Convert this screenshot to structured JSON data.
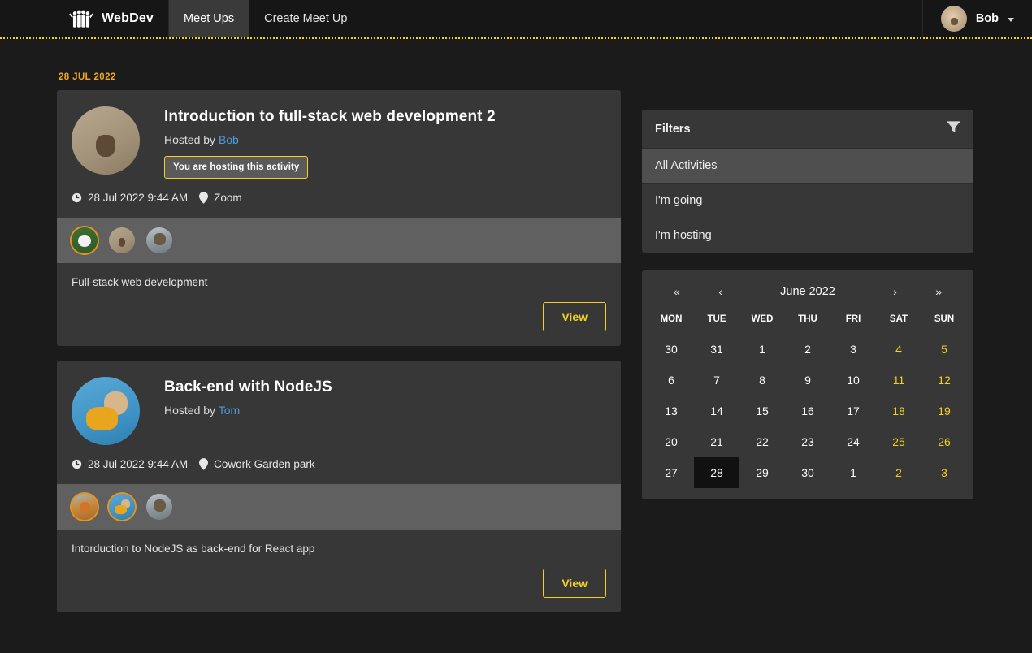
{
  "navbar": {
    "logo_icon": "group-people-icon",
    "brand": "WebDev",
    "tabs": [
      {
        "label": "Meet Ups",
        "active": true
      },
      {
        "label": "Create Meet Up",
        "active": false
      }
    ],
    "user": {
      "name": "Bob",
      "avatar": "dog-portrait-avatar",
      "caret_icon": "caret-down-icon"
    }
  },
  "page": {
    "date_header": "28 JUL 2022"
  },
  "activities": [
    {
      "title": "Introduction to full-stack web development 2",
      "hosted_by_label": "Hosted by",
      "host": "Bob",
      "hosting_badge": "You are hosting this activity",
      "show_badge": true,
      "clock_icon": "clock-icon",
      "datetime": "28 Jul 2022 9:44 AM",
      "marker_icon": "map-marker-icon",
      "venue": "Zoom",
      "description": "Full-stack web development",
      "view_label": "View",
      "avatar": "dog-on-couch-avatar",
      "attendees": [
        {
          "name": "panda-avatar",
          "host": true
        },
        {
          "name": "dog-on-couch-avatar",
          "host": false
        },
        {
          "name": "cat-avatar",
          "host": false
        }
      ]
    },
    {
      "title": "Back-end with NodeJS",
      "hosted_by_label": "Hosted by",
      "host": "Tom",
      "hosting_badge": "",
      "show_badge": false,
      "clock_icon": "clock-icon",
      "datetime": "28 Jul 2022 9:44 AM",
      "marker_icon": "map-marker-icon",
      "venue": "Cowork Garden park",
      "description": "Intorduction to NodeJS as back-end for React app",
      "view_label": "View",
      "avatar": "dog-in-yellow-hoodie-avatar",
      "attendees": [
        {
          "name": "fox-avatar",
          "host": true
        },
        {
          "name": "dog-in-yellow-hoodie-avatar",
          "host": true
        },
        {
          "name": "cat-avatar",
          "host": false
        }
      ]
    }
  ],
  "filters": {
    "title": "Filters",
    "icon": "funnel-icon",
    "items": [
      {
        "label": "All Activities",
        "active": true
      },
      {
        "label": "I'm going",
        "active": false
      },
      {
        "label": "I'm hosting",
        "active": false
      }
    ]
  },
  "calendar": {
    "month_label": "June 2022",
    "nav": {
      "prev_year": "«",
      "prev_month": "‹",
      "next_month": "›",
      "next_year": "»"
    },
    "day_names": [
      "MON",
      "TUE",
      "WED",
      "THU",
      "FRI",
      "SAT",
      "SUN"
    ],
    "weeks": [
      [
        {
          "d": "30",
          "weekend": false,
          "selected": false
        },
        {
          "d": "31",
          "weekend": false,
          "selected": false
        },
        {
          "d": "1",
          "weekend": false,
          "selected": false
        },
        {
          "d": "2",
          "weekend": false,
          "selected": false
        },
        {
          "d": "3",
          "weekend": false,
          "selected": false
        },
        {
          "d": "4",
          "weekend": true,
          "selected": false
        },
        {
          "d": "5",
          "weekend": true,
          "selected": false
        }
      ],
      [
        {
          "d": "6",
          "weekend": false,
          "selected": false
        },
        {
          "d": "7",
          "weekend": false,
          "selected": false
        },
        {
          "d": "8",
          "weekend": false,
          "selected": false
        },
        {
          "d": "9",
          "weekend": false,
          "selected": false
        },
        {
          "d": "10",
          "weekend": false,
          "selected": false
        },
        {
          "d": "11",
          "weekend": true,
          "selected": false
        },
        {
          "d": "12",
          "weekend": true,
          "selected": false
        }
      ],
      [
        {
          "d": "13",
          "weekend": false,
          "selected": false
        },
        {
          "d": "14",
          "weekend": false,
          "selected": false
        },
        {
          "d": "15",
          "weekend": false,
          "selected": false
        },
        {
          "d": "16",
          "weekend": false,
          "selected": false
        },
        {
          "d": "17",
          "weekend": false,
          "selected": false
        },
        {
          "d": "18",
          "weekend": true,
          "selected": false
        },
        {
          "d": "19",
          "weekend": true,
          "selected": false
        }
      ],
      [
        {
          "d": "20",
          "weekend": false,
          "selected": false
        },
        {
          "d": "21",
          "weekend": false,
          "selected": false
        },
        {
          "d": "22",
          "weekend": false,
          "selected": false
        },
        {
          "d": "23",
          "weekend": false,
          "selected": false
        },
        {
          "d": "24",
          "weekend": false,
          "selected": false
        },
        {
          "d": "25",
          "weekend": true,
          "selected": false
        },
        {
          "d": "26",
          "weekend": true,
          "selected": false
        }
      ],
      [
        {
          "d": "27",
          "weekend": false,
          "selected": false
        },
        {
          "d": "28",
          "weekend": false,
          "selected": true
        },
        {
          "d": "29",
          "weekend": false,
          "selected": false
        },
        {
          "d": "30",
          "weekend": false,
          "selected": false
        },
        {
          "d": "1",
          "weekend": false,
          "selected": false
        },
        {
          "d": "2",
          "weekend": true,
          "selected": false
        },
        {
          "d": "3",
          "weekend": true,
          "selected": false
        }
      ]
    ]
  },
  "colors": {
    "accent_yellow": "#f2d024",
    "accent_orange": "#f0a621",
    "link_blue": "#4f9ad8",
    "page_bg": "#1b1b1b",
    "card_bg": "#373737",
    "attendee_bar": "#606060"
  }
}
